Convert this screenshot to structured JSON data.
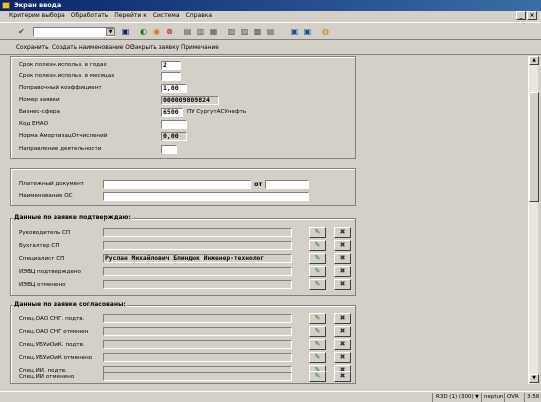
{
  "window": {
    "title": "Экран ввода"
  },
  "menu": [
    "Критерии выбора",
    "Обработать",
    "Перейти к",
    "Система",
    "Справка"
  ],
  "toolbar": {
    "command_value": "",
    "icons": [
      "enter-icon",
      "save-icon",
      "back-icon",
      "exit-icon",
      "cancel-icon",
      "print-icon",
      "find-icon",
      "find-next-icon",
      "first-page-icon",
      "prev-page-icon",
      "next-page-icon",
      "last-page-icon",
      "new-session-icon",
      "shortcut-icon",
      "help-icon"
    ]
  },
  "appbar": [
    "Сохранить",
    "Создать наименование ОС",
    "Закрыть заявку",
    "Примечание"
  ],
  "section1": {
    "rows": [
      {
        "label": "Срок полезн.использ. в годах",
        "value": "2"
      },
      {
        "label": "Срок полезн.использ. в месяцах",
        "value": ""
      },
      {
        "label": "Поправочный коэффициент",
        "value": "1,00"
      },
      {
        "label": "Номер заявки",
        "value": "000009809824"
      },
      {
        "label": "Бизнес-сфера",
        "value": "6500",
        "extra": "ПУ СургутАСУнефть"
      },
      {
        "label": "Код ЕНАО",
        "value": ""
      },
      {
        "label": "Норма АмортизацОтчислений",
        "value": "0,00"
      },
      {
        "label": "Направление деятельности",
        "value": ""
      }
    ]
  },
  "section2": {
    "payment_doc_label": "Платежный документ",
    "payment_doc_value": "",
    "from_label": "от",
    "from_value": "",
    "asset_name_label": "Наименование ОС",
    "asset_name_value": ""
  },
  "confirmed": {
    "header": "Данные по заявке подтверждаю:",
    "rows": [
      {
        "label": "Руководитель СП",
        "value": ""
      },
      {
        "label": "Бухгалтер СП",
        "value": ""
      },
      {
        "label": "Специалист СП",
        "value": "Руслан Михайлович Блиндюк Инженер-технолог"
      },
      {
        "label": "ИЭВЦ подтверждено",
        "value": ""
      },
      {
        "label": "ИЭВЦ отменено",
        "value": ""
      }
    ]
  },
  "agreed": {
    "header": "Данные по заявке согласованы:",
    "rows": [
      {
        "label": "Спец.ОАО СНГ. подтв.",
        "value": ""
      },
      {
        "label": "Спец.ОАО СНГ отменен",
        "value": ""
      },
      {
        "label": "Спец.УБУиОиК. подтв.",
        "value": ""
      },
      {
        "label": "Спец.УБУиОиК отменено",
        "value": ""
      },
      {
        "label": "Спец.ИИ. подтв.",
        "value": ""
      },
      {
        "label": "Спец.ИИ отменено",
        "value": ""
      }
    ]
  },
  "status": {
    "system": "R3D (1) (300)",
    "server": "neptun",
    "mode": "OVR",
    "time": "3:56"
  }
}
